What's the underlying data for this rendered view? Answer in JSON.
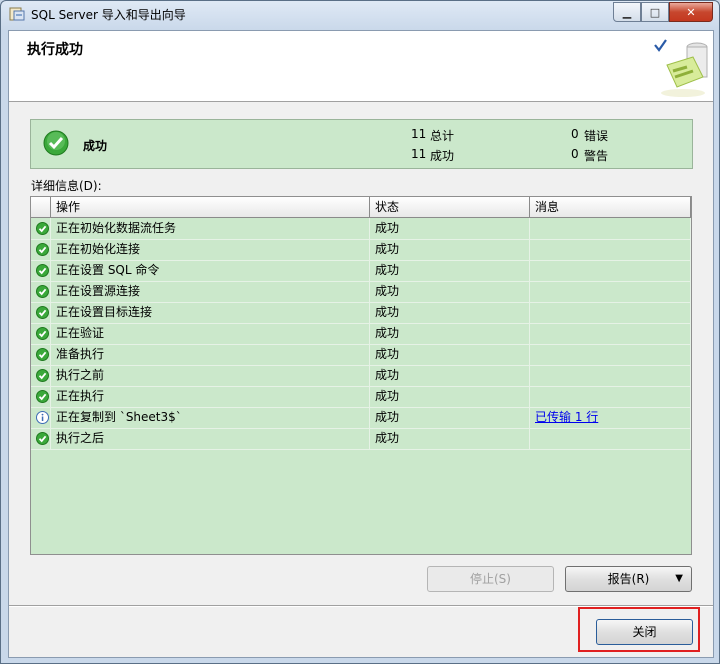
{
  "window": {
    "title": "SQL Server 导入和导出向导",
    "caption_minimize": "▁",
    "caption_maximize": "□",
    "caption_close": "✕"
  },
  "header": {
    "title": "执行成功"
  },
  "summary": {
    "status": "成功",
    "total_count": "11",
    "total_label": "总计",
    "success_count": "11",
    "success_label": "成功",
    "error_count": "0",
    "error_label": "错误",
    "warning_count": "0",
    "warning_label": "警告"
  },
  "details": {
    "label": "详细信息(D):",
    "columns": [
      "操作",
      "状态",
      "消息"
    ],
    "rows": [
      {
        "icon": "success-icon",
        "action": "正在初始化数据流任务",
        "status": "成功",
        "message": ""
      },
      {
        "icon": "success-icon",
        "action": "正在初始化连接",
        "status": "成功",
        "message": ""
      },
      {
        "icon": "success-icon",
        "action": "正在设置 SQL 命令",
        "status": "成功",
        "message": ""
      },
      {
        "icon": "success-icon",
        "action": "正在设置源连接",
        "status": "成功",
        "message": ""
      },
      {
        "icon": "success-icon",
        "action": "正在设置目标连接",
        "status": "成功",
        "message": ""
      },
      {
        "icon": "success-icon",
        "action": "正在验证",
        "status": "成功",
        "message": ""
      },
      {
        "icon": "success-icon",
        "action": "准备执行",
        "status": "成功",
        "message": ""
      },
      {
        "icon": "success-icon",
        "action": "执行之前",
        "status": "成功",
        "message": ""
      },
      {
        "icon": "success-icon",
        "action": "正在执行",
        "status": "成功",
        "message": ""
      },
      {
        "icon": "info-icon",
        "action": "正在复制到 `Sheet3$`",
        "status": "成功",
        "message": "已传输 1 行"
      },
      {
        "icon": "success-icon",
        "action": "执行之后",
        "status": "成功",
        "message": ""
      }
    ]
  },
  "buttons": {
    "stop": "停止(S)",
    "report": "报告(R)",
    "report_arrow": "▼",
    "close": "关闭"
  },
  "colors": {
    "success_green": "#cbe8cb",
    "highlight_red": "#e02020",
    "link_blue": "#0000ee"
  }
}
